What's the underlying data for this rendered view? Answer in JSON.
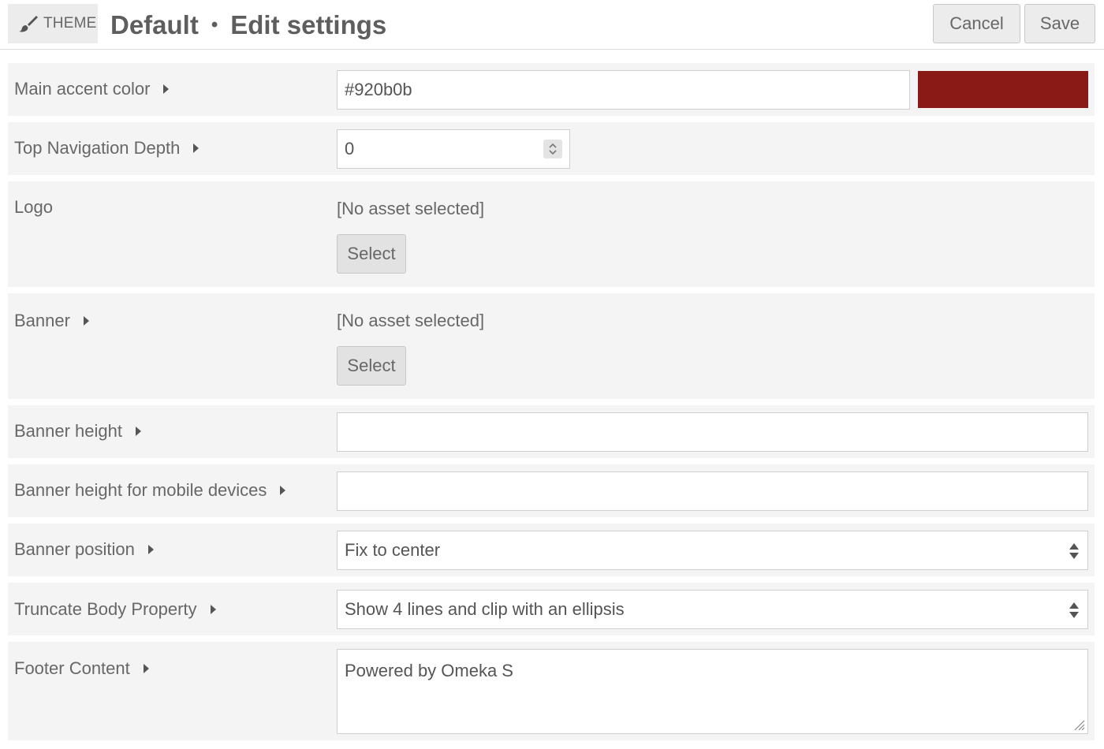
{
  "header": {
    "theme_label": "THEME",
    "theme_name": "Default",
    "separator": "•",
    "page_title": "Edit settings",
    "cancel_label": "Cancel",
    "save_label": "Save"
  },
  "fields": {
    "accent_color": {
      "label": "Main accent color",
      "value": "#920b0b",
      "swatch_color": "#8a1a16"
    },
    "nav_depth": {
      "label": "Top Navigation Depth",
      "value": "0"
    },
    "logo": {
      "label": "Logo",
      "status": "[No asset selected]",
      "button": "Select"
    },
    "banner": {
      "label": "Banner",
      "status": "[No asset selected]",
      "button": "Select"
    },
    "banner_height": {
      "label": "Banner height",
      "value": ""
    },
    "banner_height_mobile": {
      "label": "Banner height for mobile devices",
      "value": ""
    },
    "banner_position": {
      "label": "Banner position",
      "selected": "Fix to center"
    },
    "truncate_body": {
      "label": "Truncate Body Property",
      "selected": "Show 4 lines and clip with an ellipsis"
    },
    "footer_content": {
      "label": "Footer Content",
      "value": "Powered by Omeka S"
    }
  },
  "icons": {
    "theme": "paintbrush-icon",
    "expand": "caret-right-icon",
    "spinner": "number-spinner-icon",
    "select_arrows": "select-updown-icon",
    "resize": "resize-handle-icon"
  }
}
